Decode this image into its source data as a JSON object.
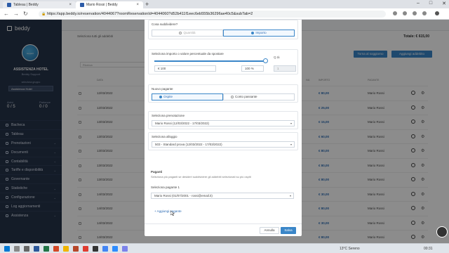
{
  "browser": {
    "tabs": [
      {
        "title": "Tableau | Beddy"
      },
      {
        "title": "Mario Rossi | Beddy"
      }
    ],
    "url": "https://app.beddy.io/reservation/4044067?roomReservationId=4044060?d52b411f1eec6eb555b36296ae40c5&subTab=2",
    "new_tab": "+",
    "controls": [
      "–",
      "□",
      "✕"
    ]
  },
  "sidebar": {
    "brand": "beddy",
    "avatar_text": "support",
    "hotel_name": "ASSISTENZA HOTEL",
    "hotel_sub": "Beddy Support",
    "group_label": "seleziona gruppo",
    "group_value": "Assistenza Hotel",
    "stats": [
      {
        "label": "Arrivi",
        "value": "0 / 5"
      },
      {
        "label": "Partenze",
        "value": "0 / 0"
      }
    ],
    "items": [
      {
        "label": "Bacheca",
        "chev": ""
      },
      {
        "label": "Tableau",
        "chev": ""
      },
      {
        "label": "Prenotazioni",
        "chev": "⌄"
      },
      {
        "label": "Documenti",
        "chev": "⌄"
      },
      {
        "label": "Contabilità",
        "chev": "⌄"
      },
      {
        "label": "Tariffe e disponibilità",
        "chev": "⌄"
      },
      {
        "label": "Governante",
        "chev": ""
      },
      {
        "label": "Statistiche",
        "chev": "⌄"
      },
      {
        "label": "Configurazione",
        "chev": "⌄"
      },
      {
        "label": "Log aggiornamenti",
        "chev": ""
      },
      {
        "label": "Assistenza",
        "chev": "⌄"
      }
    ]
  },
  "page": {
    "select_all": "Seleziona tutti gli addebiti",
    "total": "Totale: € 615,00",
    "add_payment_btn": "Torna al soggiorno",
    "add_charge_btn": "Aggiungi addebito",
    "filter_placeholder": "Ricerca",
    "headers": {
      "date": "DATA",
      "amount": "IMPORTO",
      "payer": "PAGANTE",
      "iva": "IVA"
    },
    "rows": [
      {
        "date": "12/03/2022",
        "amount": "€ 80,00",
        "payer": "Mario Rossi"
      },
      {
        "date": "12/03/2022",
        "amount": "€ 25,00",
        "payer": "Mario Rossi"
      },
      {
        "date": "13/03/2022",
        "amount": "€ 15,00",
        "payer": "Mario Rossi"
      },
      {
        "date": "13/03/2022",
        "amount": "€ 60,00",
        "payer": "Mario Rossi"
      },
      {
        "date": "13/03/2022",
        "amount": "€ 80,00",
        "payer": "Mario Rossi"
      },
      {
        "date": "13/03/2022",
        "amount": "€ 80,00",
        "payer": "Mario Rossi"
      },
      {
        "date": "13/03/2022",
        "amount": "€ 80,00",
        "payer": "Mario Rossi"
      },
      {
        "date": "14/03/2022",
        "amount": "€ 30,00",
        "payer": "Mario Rossi"
      },
      {
        "date": "14/03/2022",
        "amount": "€ 80,00",
        "payer": "Mario Rossi"
      },
      {
        "date": "14/03/2022",
        "amount": "€ 30,00",
        "payer": "Mario Rossi"
      },
      {
        "date": "14/03/2022",
        "amount": "€ 80,00",
        "payer": "Mario Rossi"
      },
      {
        "date": "14/03/2022",
        "amount": "€ 80,00",
        "payer": "Mario Rossi"
      }
    ]
  },
  "modal": {
    "what_label": "Cosa suddividere?",
    "opt_quantity": "Quantità",
    "opt_amount": "Importo",
    "slider_label": "Seleziona importo o valore percentuale da spostare",
    "slider_value_percent": 100,
    "amount_value": "€ 100",
    "percent_value": "100 %",
    "qty_label": "Q.tà",
    "qty_value": "1",
    "new_payer_label": "Nuovo pagante",
    "opt_guest": "Ospite",
    "opt_account": "Conto passante",
    "reservation_label": "Seleziona prenotazione",
    "reservation_value": "Mario Rossi (12/03/2022 - 17/03/2022)",
    "room_label": "Seleziona alloggio",
    "room_value": "503 - Standard prova (12/03/2022 - 17/03/2022)",
    "payers_title": "Paganti",
    "payers_desc": "Seleziona più paganti se desideri suddividere gli addebiti selezionati su più ospiti",
    "payer1_label": "Seleziona pagante 1",
    "payer1_value": "Mario Rossi (01/07/2001 - rossi@email.it)",
    "add_payer": "Aggiungi pagante",
    "cancel": "Annulla",
    "save": "Salva"
  },
  "taskbar": {
    "weather": "13°C Sereno",
    "time": "00:31"
  },
  "colors": {
    "accent": "#3a86c8",
    "sidebar": "#26334a",
    "amount": "#2e6db4"
  }
}
